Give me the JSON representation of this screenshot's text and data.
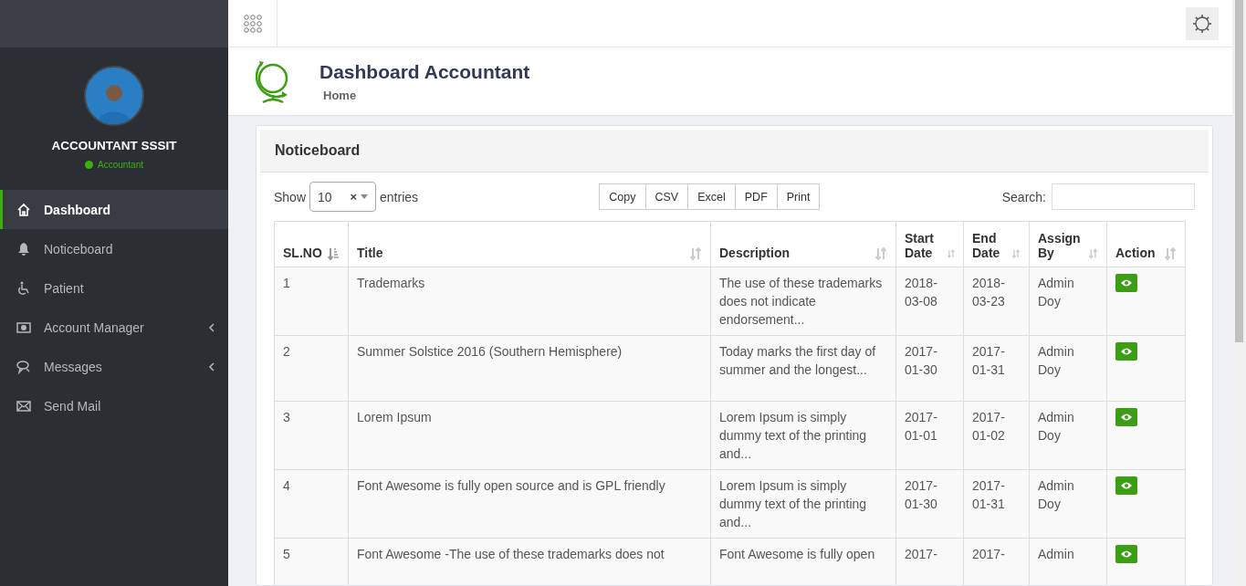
{
  "sidebar": {
    "user_name": "ACCOUNTANT SSSIT",
    "role": "Accountant",
    "items": [
      {
        "label": "Dashboard",
        "selected": true,
        "has_submenu": false
      },
      {
        "label": "Noticeboard",
        "selected": false,
        "has_submenu": false
      },
      {
        "label": "Patient",
        "selected": false,
        "has_submenu": false
      },
      {
        "label": "Account Manager",
        "selected": false,
        "has_submenu": true
      },
      {
        "label": "Messages",
        "selected": false,
        "has_submenu": true
      },
      {
        "label": "Send Mail",
        "selected": false,
        "has_submenu": false
      }
    ]
  },
  "page_header": {
    "title": "Dashboard Accountant",
    "breadcrumb": "Home"
  },
  "card": {
    "title": "Noticeboard",
    "show_label": "Show",
    "page_size": "10",
    "clear_symbol": "×",
    "entries_label": "entries",
    "export_buttons": [
      "Copy",
      "CSV",
      "Excel",
      "PDF",
      "Print"
    ],
    "search_label": "Search:",
    "columns": [
      {
        "label": "SL.NO",
        "sorted": true
      },
      {
        "label": "Title",
        "sorted": false
      },
      {
        "label": "Description",
        "sorted": false
      },
      {
        "label": "Start Date",
        "sorted": false
      },
      {
        "label": "End Date",
        "sorted": false
      },
      {
        "label": "Assign By",
        "sorted": false
      },
      {
        "label": "Action",
        "sorted": false
      }
    ],
    "rows": [
      {
        "sl_no": "1",
        "title": "Trademarks",
        "description": "The use of these trademarks does not indicate endorsement...",
        "start_date": "2018-03-08",
        "end_date": "2018-03-23",
        "assign_by": "Admin Doy"
      },
      {
        "sl_no": "2",
        "title": "Summer Solstice 2016 (Southern Hemisphere)",
        "description": "Today marks the first day of summer and the longest...",
        "start_date": "2017-01-30",
        "end_date": "2017-01-31",
        "assign_by": "Admin Doy"
      },
      {
        "sl_no": "3",
        "title": "Lorem Ipsum",
        "description": "Lorem Ipsum is simply dummy text of the printing and...",
        "start_date": "2017-01-01",
        "end_date": "2017-01-02",
        "assign_by": "Admin Doy"
      },
      {
        "sl_no": "4",
        "title": "Font Awesome is fully open source and is GPL friendly",
        "description": "Lorem Ipsum is simply dummy text of the printing and...",
        "start_date": "2017-01-30",
        "end_date": "2017-01-31",
        "assign_by": "Admin Doy"
      },
      {
        "sl_no": "5",
        "title": "Font Awesome -The use of these trademarks does not",
        "description": "Font Awesome is fully open",
        "start_date": "2017-",
        "end_date": "2017-",
        "assign_by": "Admin"
      }
    ]
  }
}
